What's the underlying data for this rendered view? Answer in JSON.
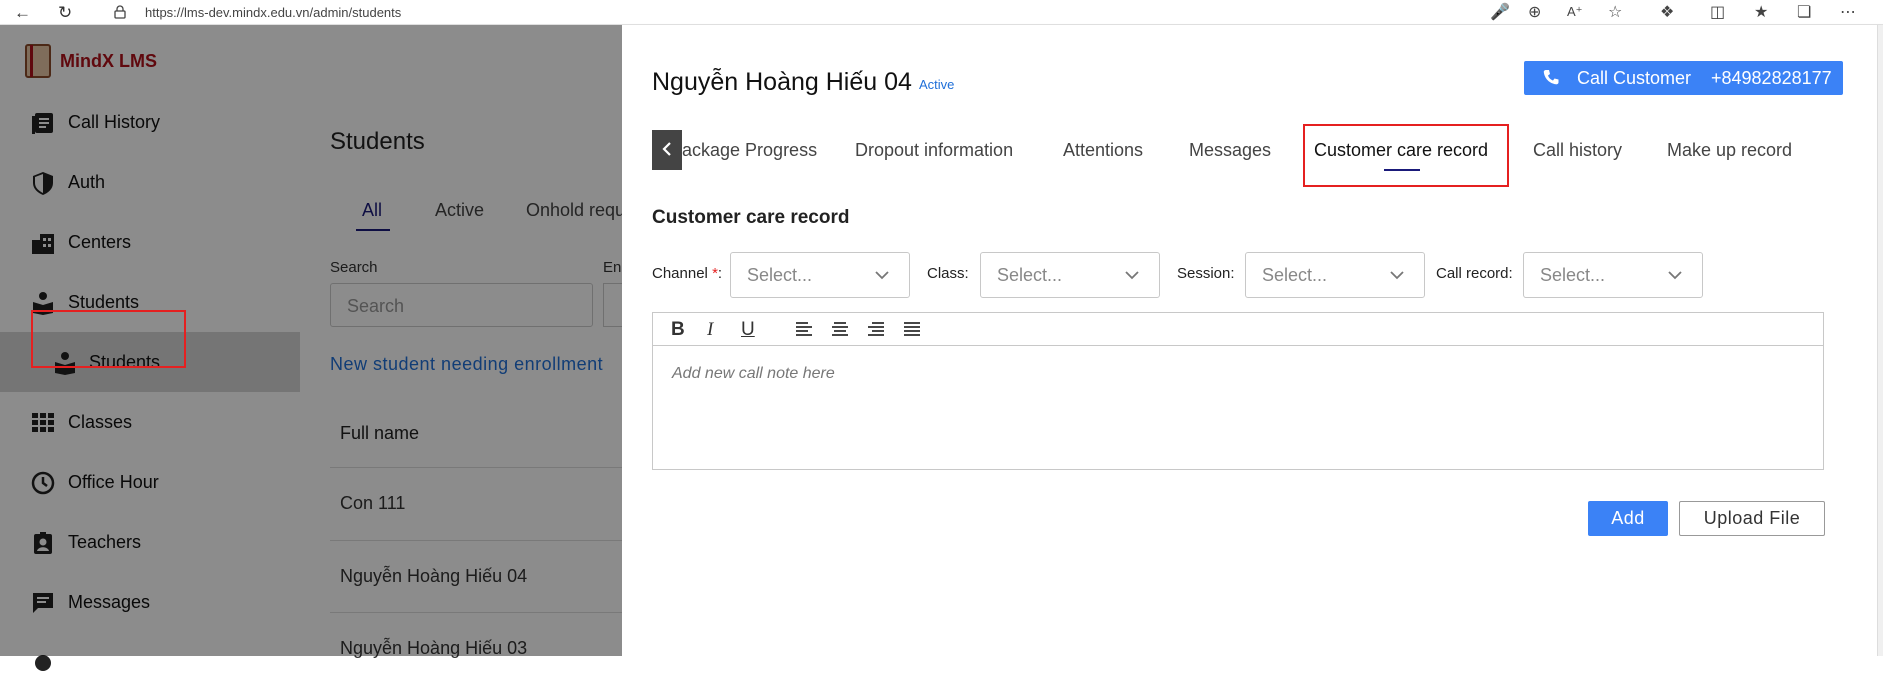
{
  "browser": {
    "url": "https://lms-dev.mindx.edu.vn/admin/students"
  },
  "app": {
    "logo_text": "MindX LMS",
    "sidebar": {
      "items": [
        {
          "label": "Call History"
        },
        {
          "label": "Auth"
        },
        {
          "label": "Centers"
        },
        {
          "label": "Students"
        },
        {
          "label": "Students"
        },
        {
          "label": "Classes"
        },
        {
          "label": "Office Hour"
        },
        {
          "label": "Teachers"
        },
        {
          "label": "Messages"
        }
      ]
    },
    "page": {
      "title": "Students",
      "tabs": [
        "All",
        "Active",
        "Onhold requ"
      ],
      "search_label": "Search",
      "search_placeholder": "Search",
      "partial_label": "En",
      "new_link": "New student needing enrollment",
      "table_header": "Full name",
      "rows": [
        "Con 111",
        "Nguyễn Hoàng Hiếu 04",
        "Nguyễn Hoàng Hiếu 03"
      ]
    }
  },
  "drawer": {
    "student_name": "Nguyễn Hoàng Hiếu 04",
    "status": "Active",
    "call_button": {
      "label": "Call Customer",
      "phone": "+84982828177"
    },
    "tabs": [
      {
        "label": "ackage Progress"
      },
      {
        "label": "Dropout information"
      },
      {
        "label": "Attentions"
      },
      {
        "label": "Messages"
      },
      {
        "label": "Customer care record"
      },
      {
        "label": "Call history"
      },
      {
        "label": "Make up record"
      }
    ],
    "section_title": "Customer care record",
    "fields": {
      "channel": {
        "label": "Channel",
        "required_mark": "*",
        "suffix": ":",
        "placeholder": "Select..."
      },
      "class": {
        "label": "Class:",
        "placeholder": "Select..."
      },
      "session": {
        "label": "Session:",
        "placeholder": "Select..."
      },
      "call_record": {
        "label": "Call record:",
        "placeholder": "Select..."
      }
    },
    "editor": {
      "bold": "B",
      "italic": "I",
      "underline": "U",
      "placeholder": "Add new call note here"
    },
    "add_label": "Add",
    "upload_label": "Upload File"
  },
  "colors": {
    "accent": "#3b82f6",
    "link": "#1f6fd8",
    "highlight": "#e52020",
    "brand": "#b0121b"
  }
}
